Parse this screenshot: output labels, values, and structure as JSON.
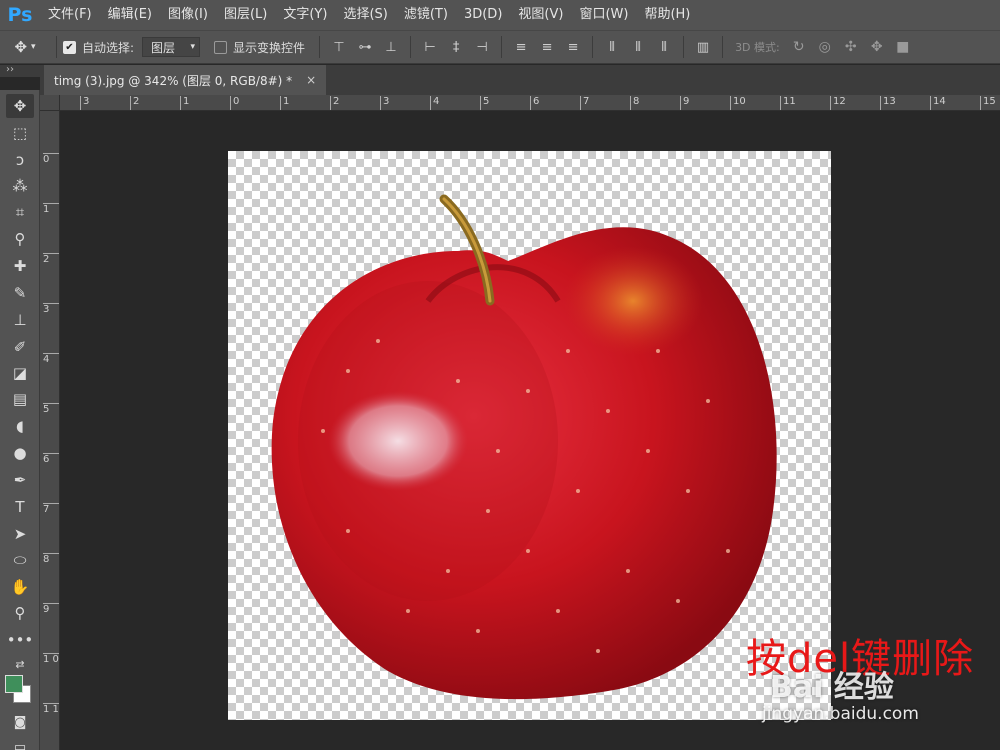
{
  "app": {
    "logo": "Ps"
  },
  "menu": [
    "文件(F)",
    "编辑(E)",
    "图像(I)",
    "图层(L)",
    "文字(Y)",
    "选择(S)",
    "滤镜(T)",
    "3D(D)",
    "视图(V)",
    "窗口(W)",
    "帮助(H)"
  ],
  "options": {
    "auto_select_label": "自动选择:",
    "auto_select_checked": true,
    "auto_select_target": "图层",
    "show_transform_label": "显示变换控件",
    "show_transform_checked": false,
    "mode_3d_label": "3D 模式:"
  },
  "tab": {
    "title": "timg (3).jpg @ 342% (图层 0, RGB/8#) *",
    "close": "×"
  },
  "ruler": {
    "h_labels": [
      "3",
      "2",
      "1",
      "0",
      "1",
      "2",
      "3",
      "4",
      "5",
      "6",
      "7",
      "8",
      "9",
      "10",
      "11",
      "12",
      "13",
      "14",
      "15"
    ],
    "v_labels": [
      "0",
      "1",
      "2",
      "3",
      "4",
      "5",
      "6",
      "7",
      "8",
      "9",
      "1 0",
      "1 1"
    ]
  },
  "overlay": {
    "instruction": "按del键删除",
    "watermark_main": "Bai 经验",
    "watermark_sub": "jingyan.baidu.com"
  },
  "colors": {
    "foreground": "#3f8f5b",
    "background": "#ffffff",
    "apple_red": "#c8141e"
  }
}
